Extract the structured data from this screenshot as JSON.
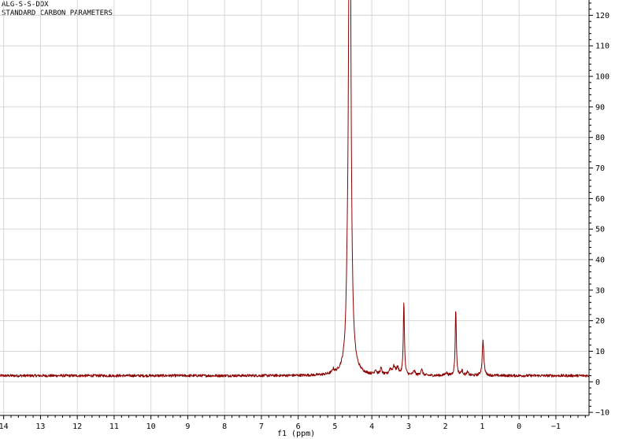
{
  "header": {
    "line1": "ALG-S-S-DOX",
    "line2": "STANDARD CARBON PARAMETERS"
  },
  "chart_data": {
    "type": "line",
    "title": "ALG-S-S-DOX",
    "subtitle": "STANDARD CARBON PARAMETERS",
    "xlabel": "f1 (ppm)",
    "ylabel": "",
    "xlim": [
      14.1,
      -1.9
    ],
    "ylim": [
      -11,
      125
    ],
    "x_reversed": true,
    "x_ticks": [
      14,
      13,
      12,
      11,
      10,
      9,
      8,
      7,
      6,
      5,
      4,
      3,
      2,
      1,
      0,
      -1
    ],
    "x_tick_labels": [
      "14",
      "13",
      "12",
      "11",
      "10",
      "9",
      "8",
      "7",
      "6",
      "5",
      "4",
      "3",
      "2",
      "1",
      "0",
      "−1"
    ],
    "y_ticks": [
      -10,
      0,
      10,
      20,
      30,
      40,
      50,
      60,
      70,
      80,
      90,
      100,
      110,
      120
    ],
    "y_tick_labels": [
      "−10",
      "0",
      "10",
      "20",
      "30",
      "40",
      "50",
      "60",
      "70",
      "80",
      "90",
      "100",
      "110",
      "120"
    ],
    "y_axis_side": "right",
    "grid": true,
    "baseline": 2,
    "peaks": [
      {
        "x": 4.6,
        "height": 200,
        "width": 0.035
      },
      {
        "x": 4.67,
        "height": 9,
        "width": 0.03
      },
      {
        "x": 5.05,
        "height": 1.2,
        "width": 0.03
      },
      {
        "x": 3.9,
        "height": 1.5,
        "width": 0.03
      },
      {
        "x": 3.75,
        "height": 2.0,
        "width": 0.03
      },
      {
        "x": 3.5,
        "height": 1.8,
        "width": 0.04
      },
      {
        "x": 3.4,
        "height": 2.5,
        "width": 0.04
      },
      {
        "x": 3.3,
        "height": 2.2,
        "width": 0.04
      },
      {
        "x": 3.13,
        "height": 24,
        "width": 0.018
      },
      {
        "x": 2.85,
        "height": 1.5,
        "width": 0.03
      },
      {
        "x": 2.65,
        "height": 2.0,
        "width": 0.03
      },
      {
        "x": 1.98,
        "height": 1.0,
        "width": 0.03
      },
      {
        "x": 1.72,
        "height": 22,
        "width": 0.018
      },
      {
        "x": 1.55,
        "height": 1.5,
        "width": 0.03
      },
      {
        "x": 1.4,
        "height": 1.0,
        "width": 0.03
      },
      {
        "x": 0.98,
        "height": 11.5,
        "width": 0.025
      }
    ],
    "line_color": "#8b0000",
    "grid_color": "#d6d6d6"
  }
}
